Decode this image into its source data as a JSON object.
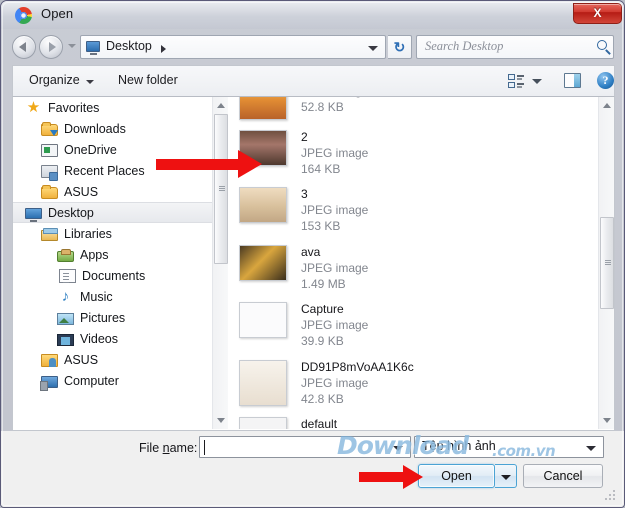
{
  "window": {
    "title": "Open",
    "title_icon": "chrome-logo-icon",
    "close_label": "X"
  },
  "nav": {
    "back_icon": "back-arrow-icon",
    "forward_icon": "forward-arrow-icon",
    "history_icon": "chevron-down-icon",
    "address_icon": "desktop-monitor-icon",
    "address_path": "Desktop",
    "address_separator_icon": "chevron-right-icon",
    "address_dropdown_icon": "chevron-down-icon",
    "refresh_icon": "refresh-icon",
    "refresh_glyph": "↻",
    "search_placeholder": "Search Desktop",
    "search_value": "",
    "search_icon": "magnifier-icon"
  },
  "toolbar": {
    "organize_label": "Organize",
    "organize_caret_icon": "caret-down-icon",
    "new_folder_label": "New folder",
    "view_mode_icon": "view-list-icon",
    "view_caret_icon": "caret-down-icon",
    "preview_pane_icon": "preview-pane-icon",
    "help_icon": "help-icon",
    "help_glyph": "?"
  },
  "sidebar": {
    "items": [
      {
        "label": "Favorites",
        "icon": "star-icon",
        "indent": 0,
        "selected": false
      },
      {
        "label": "Downloads",
        "icon": "downloads-icon",
        "indent": 1,
        "selected": false
      },
      {
        "label": "OneDrive",
        "icon": "onedrive-icon",
        "indent": 1,
        "selected": false
      },
      {
        "label": "Recent Places",
        "icon": "recent-places-icon",
        "indent": 1,
        "selected": false
      },
      {
        "label": "ASUS",
        "icon": "folder-icon",
        "indent": 1,
        "selected": false
      },
      {
        "label": "Desktop",
        "icon": "desktop-icon",
        "indent": 0,
        "selected": true
      },
      {
        "label": "Libraries",
        "icon": "libraries-icon",
        "indent": 1,
        "selected": false
      },
      {
        "label": "Apps",
        "icon": "apps-icon",
        "indent": 2,
        "selected": false
      },
      {
        "label": "Documents",
        "icon": "documents-icon",
        "indent": 2,
        "selected": false
      },
      {
        "label": "Music",
        "icon": "music-icon",
        "indent": 2,
        "selected": false
      },
      {
        "label": "Pictures",
        "icon": "pictures-icon",
        "indent": 2,
        "selected": false
      },
      {
        "label": "Videos",
        "icon": "videos-icon",
        "indent": 2,
        "selected": false
      },
      {
        "label": "ASUS",
        "icon": "user-folder-icon",
        "indent": 1,
        "selected": false
      },
      {
        "label": "Computer",
        "icon": "computer-icon",
        "indent": 1,
        "selected": false
      }
    ]
  },
  "files": {
    "items": [
      {
        "name": "",
        "type": "JPEG image",
        "size": "52.8 KB",
        "thumb": "sunset-beach",
        "clipped_top": true,
        "tall": false
      },
      {
        "name": "2",
        "type": "JPEG image",
        "size": "164 KB",
        "thumb": "child-dusk",
        "clipped_top": false,
        "tall": false
      },
      {
        "name": "3",
        "type": "JPEG image",
        "size": "153 KB",
        "thumb": "hand-light",
        "clipped_top": false,
        "tall": false
      },
      {
        "name": "ava",
        "type": "JPEG image",
        "size": "1.49 MB",
        "thumb": "warm-bokeh",
        "clipped_top": false,
        "tall": false
      },
      {
        "name": "Capture",
        "type": "JPEG image",
        "size": "39.9 KB",
        "thumb": "screenshot",
        "clipped_top": false,
        "tall": false
      },
      {
        "name": "DD91P8mVoAA1K6c",
        "type": "JPEG image",
        "size": "42.8 KB",
        "thumb": "comic-strip",
        "clipped_top": false,
        "tall": true
      },
      {
        "name": "default",
        "type": "",
        "size": "",
        "thumb": "blank",
        "clipped_top": false,
        "tall": false
      }
    ]
  },
  "scrollbars": {
    "up_icon": "scroll-up-arrow-icon",
    "down_icon": "scroll-down-arrow-icon"
  },
  "footer": {
    "file_name_label_pre": "File ",
    "file_name_label_key": "n",
    "file_name_label_post": "ame:",
    "file_name_value": "",
    "file_name_dropdown_icon": "caret-down-icon",
    "filter_value": "Tệp hình ảnh",
    "filter_dropdown_icon": "caret-down-icon",
    "open_label": "Open",
    "open_split_icon": "caret-down-icon",
    "cancel_label": "Cancel",
    "resize_grip_icon": "resize-grip-icon"
  },
  "watermark": {
    "main": "Download",
    "sub": ".com.vn"
  },
  "annotations": {
    "arrow_file_name": "red-arrow-pointing-to-file-2",
    "arrow_open_name": "red-arrow-pointing-to-open-button"
  },
  "colors": {
    "accent": "#4ba3d4",
    "annotation": "#ee1111",
    "close": "#c33227",
    "watermark": "#78afda"
  }
}
